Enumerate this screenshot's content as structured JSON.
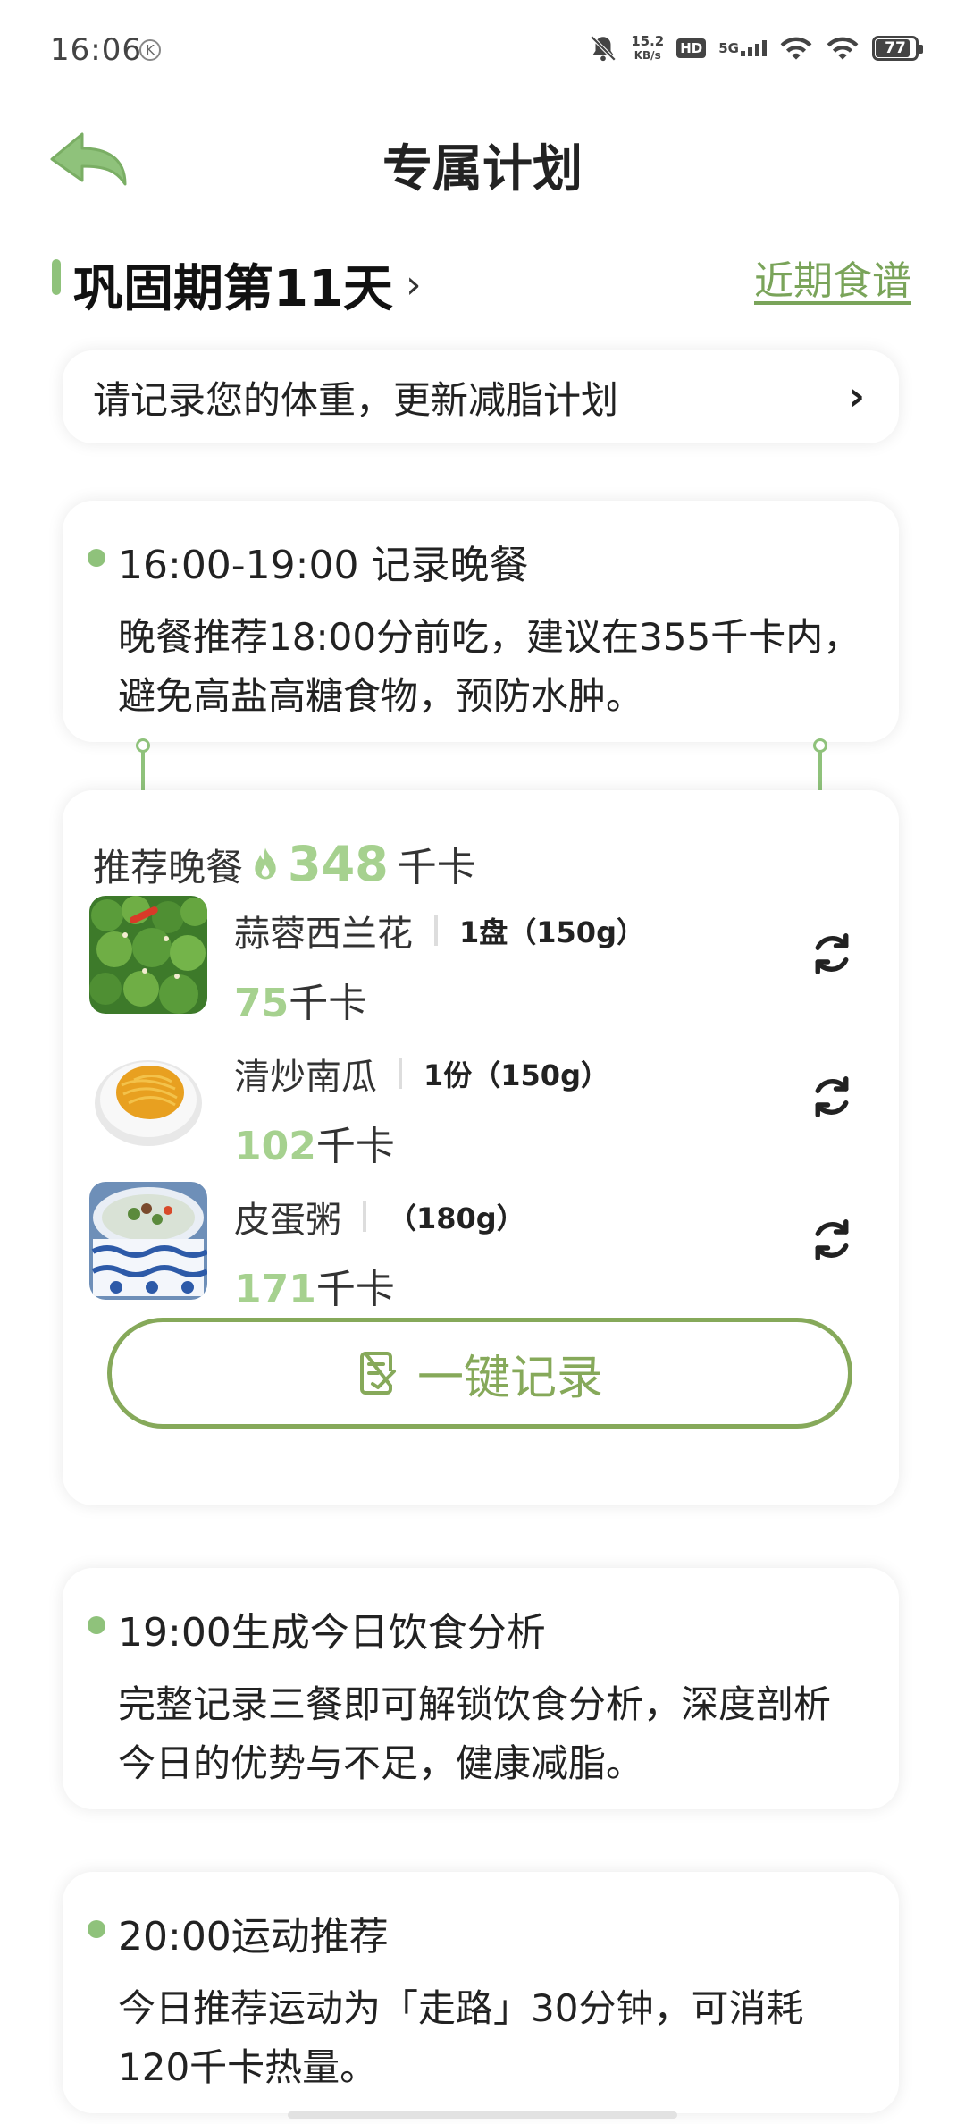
{
  "status_bar": {
    "time": "16:06",
    "k_badge": "K",
    "net_speed_value": "15.2",
    "net_speed_unit": "KB/s",
    "hd_label": "HD",
    "signal_label": "5G",
    "battery": "77"
  },
  "header": {
    "title": "专属计划"
  },
  "phase": {
    "title": "巩固期第11天",
    "recent_recipes_link": "近期食谱"
  },
  "weight_prompt": {
    "text": "请记录您的体重，更新减脂计划"
  },
  "dinner_plan": {
    "time_title": "16:00-19:00 记录晚餐",
    "description": "晚餐推荐18:00分前吃，建议在355千卡内，避免高盐高糖食物，预防水肿。"
  },
  "recommended_meal": {
    "label": "推荐晚餐",
    "kcal_value": "348",
    "kcal_unit": "千卡",
    "foods": [
      {
        "name": "蒜蓉西兰花",
        "quantity": "1盘（150g）",
        "kcal": "75",
        "kcal_unit": "千卡"
      },
      {
        "name": "清炒南瓜",
        "quantity": "1份（150g）",
        "kcal": "102",
        "kcal_unit": "千卡"
      },
      {
        "name": "皮蛋粥",
        "quantity": "（180g）",
        "kcal": "171",
        "kcal_unit": "千卡"
      }
    ],
    "record_button": "一键记录"
  },
  "analysis_plan": {
    "time_title": "19:00生成今日饮食分析",
    "description": "完整记录三餐即可解锁饮食分析，深度剖析今日的优势与不足，健康减脂。"
  },
  "exercise_plan": {
    "time_title": "20:00运动推荐",
    "description": "今日推荐运动为「走路」30分钟，可消耗120千卡热量。"
  },
  "colors": {
    "accent_green": "#8fc27b",
    "kcal_green": "#a6d18f",
    "button_green": "#86a95a"
  }
}
